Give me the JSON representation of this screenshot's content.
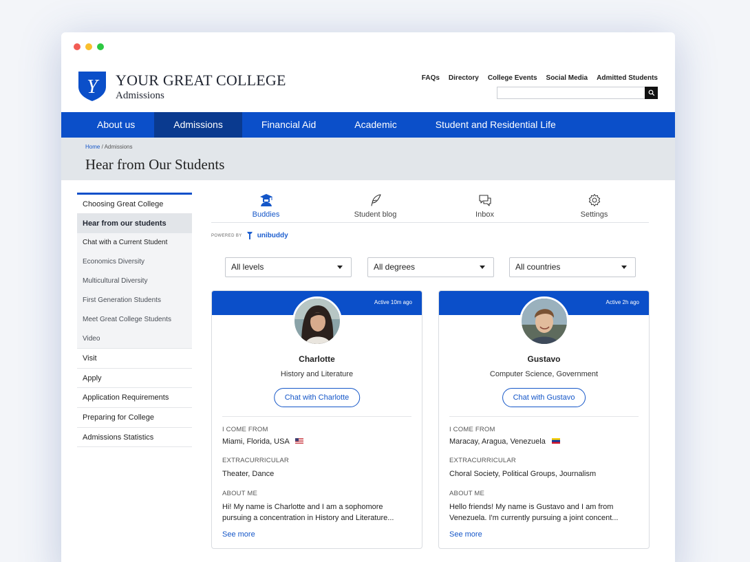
{
  "brand": {
    "title": "YOUR GREAT COLLEGE",
    "subtitle": "Admissions",
    "logo_letter": "Y"
  },
  "utility_links": [
    "FAQs",
    "Directory",
    "College Events",
    "Social Media",
    "Admitted Students"
  ],
  "search": {
    "placeholder": ""
  },
  "nav": {
    "items": [
      "About us",
      "Admissions",
      "Financial Aid",
      "Academic",
      "Student and Residential Life"
    ],
    "active": "Admissions"
  },
  "breadcrumb": {
    "home": "Home",
    "separator": "/",
    "current": "Admissions"
  },
  "page_title": "Hear from Our Students",
  "sidebar": {
    "sub_items": [
      "Choosing Great College",
      "Hear from our students",
      "Chat with a Current Student",
      "Economics Diversity",
      "Multicultural Diversity",
      "First Generation Students",
      "Meet Great College Students",
      "Video"
    ],
    "selected": "Hear from our students",
    "main_items": [
      "Visit",
      "Apply",
      "Application Requirements",
      "Preparing for College",
      "Admissions Statistics"
    ]
  },
  "tabs": [
    {
      "label": "Buddies",
      "icon": "graduate-icon",
      "active": true
    },
    {
      "label": "Student blog",
      "icon": "feather-icon",
      "active": false
    },
    {
      "label": "Inbox",
      "icon": "chat-bubbles-icon",
      "active": false
    },
    {
      "label": "Settings",
      "icon": "gear-icon",
      "active": false
    }
  ],
  "powered_by": {
    "label": "POWERED BY",
    "brand": "unibuddy"
  },
  "filters": [
    "All levels",
    "All degrees",
    "All countries"
  ],
  "colors": {
    "primary": "#0b4fc9",
    "nav_active": "#0a3a8f",
    "link": "#1456c8",
    "banner": "#e2e6ea"
  },
  "cards": [
    {
      "active": "Active 10m ago",
      "name": "Charlotte",
      "subject": "History and Literature",
      "chat_label": "Chat with Charlotte",
      "from_label": "I COME FROM",
      "from": "Miami, Florida, USA",
      "flag": "flag-usa-icon",
      "extra_label": "EXTRACURRICULAR",
      "extra": "Theater, Dance",
      "about_label": "ABOUT ME",
      "about": "Hi! My name is Charlotte and I am a sophomore pursuing a concentration in History and Literature...",
      "see_more": "See more"
    },
    {
      "active": "Active 2h ago",
      "name": "Gustavo",
      "subject": "Computer Science, Government",
      "chat_label": "Chat with Gustavo",
      "from_label": "I COME FROM",
      "from": "Maracay, Aragua, Venezuela",
      "flag": "flag-venezuela-icon",
      "extra_label": "EXTRACURRICULAR",
      "extra": "Choral Society, Political Groups, Journalism",
      "about_label": "ABOUT ME",
      "about": "Hello friends! My name is Gustavo and I am from Venezuela. I'm currently pursuing a joint concent...",
      "see_more": "See more"
    }
  ]
}
